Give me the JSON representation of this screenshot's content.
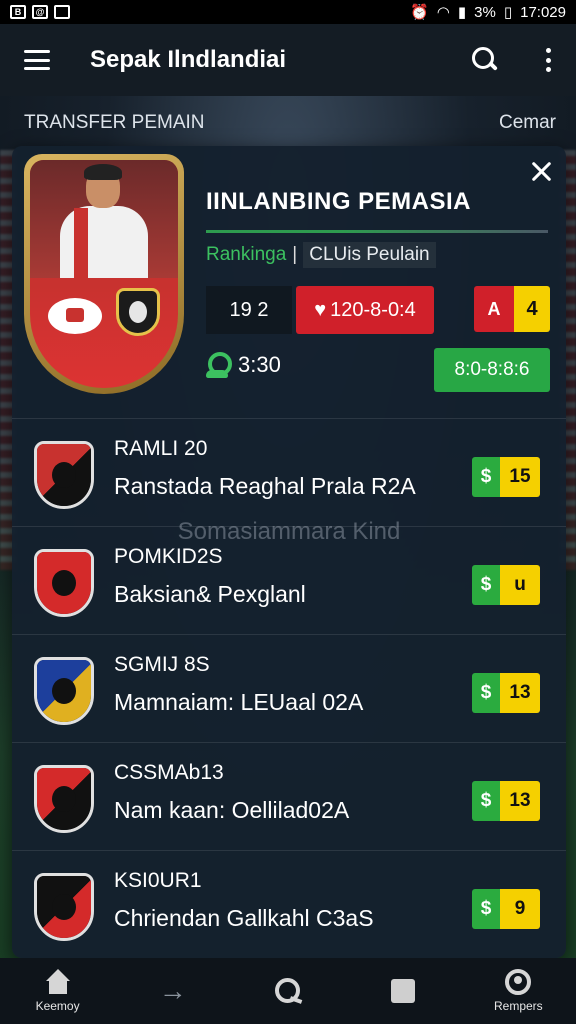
{
  "status_bar": {
    "time": "17:029",
    "battery": "3%"
  },
  "app_bar": {
    "title": "Sepak Ilndlandiai"
  },
  "section": {
    "title": "TRANSFER PEMAIN",
    "action": "Cemar"
  },
  "player": {
    "name": "IINLANBING PEMASIA",
    "meta_green": "Rankinga",
    "meta_sep": "|",
    "meta_box": "CLUis Peulain",
    "stat": "19 2",
    "price": "120-8-0:4",
    "flag_letter": "A",
    "flag_value": "4",
    "time": "3:30",
    "button": "8:0-8:8:6"
  },
  "watermark": "Somasiammara Kind",
  "transfers": [
    {
      "code": "RAMLI 20",
      "desc": "Ranstada  Reaghal Prala R2A",
      "currency": "$",
      "value": "15",
      "crest_a": "#c8322f",
      "crest_b": "#111111"
    },
    {
      "code": "POMKID2S",
      "desc": "Baksian& Pexglanl",
      "currency": "$",
      "value": "u",
      "crest_a": "#d42a2a",
      "crest_b": "#d42a2a"
    },
    {
      "code": "SGMIJ 8S",
      "desc": "Mamnaiam:  LEUaal 02A",
      "currency": "$",
      "value": "13",
      "crest_a": "#1d3f9c",
      "crest_b": "#e0b020"
    },
    {
      "code": "CSSMAb13",
      "desc": "Nam kaan: Oellilad02A",
      "currency": "$",
      "value": "13",
      "crest_a": "#d42a2a",
      "crest_b": "#111111"
    },
    {
      "code": "KSI0UR1",
      "desc": "Chriendan  Gallkahl C3aS",
      "currency": "$",
      "value": "9",
      "crest_a": "#111111",
      "crest_b": "#d42a2a"
    }
  ],
  "bottom_nav": {
    "home_label": "Keemoy",
    "profile_label": "Rempers"
  }
}
